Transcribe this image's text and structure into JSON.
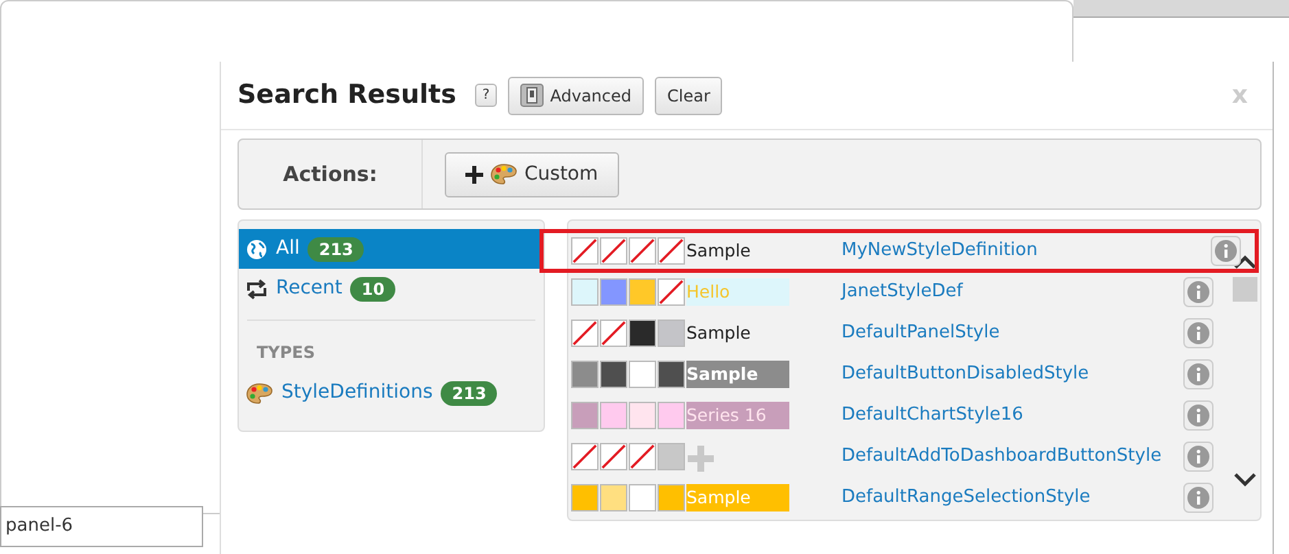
{
  "background_field": {
    "value": "panel-6"
  },
  "dialog": {
    "title": "Search Results",
    "help": "?",
    "advanced": "Advanced",
    "clear": "Clear",
    "close": "x"
  },
  "actions": {
    "label": "Actions:",
    "button": "Custom"
  },
  "sidebar": {
    "items": [
      {
        "label": "All",
        "count": "213",
        "selected": true
      },
      {
        "label": "Recent",
        "count": "10",
        "selected": false
      }
    ],
    "section": "TYPES",
    "types": [
      {
        "label": "StyleDefinitions",
        "count": "213"
      }
    ]
  },
  "results": [
    {
      "swatches": [
        {
          "kind": "none"
        },
        {
          "kind": "none"
        },
        {
          "kind": "none"
        },
        {
          "kind": "none"
        }
      ],
      "sample": {
        "kind": "text",
        "text": "Sample",
        "color": "#222222",
        "bold": false
      },
      "name": "MyNewStyleDefinition",
      "selected": true
    },
    {
      "swatches": [
        {
          "kind": "color",
          "color": "#ddf6fb"
        },
        {
          "kind": "color",
          "color": "#8396ff"
        },
        {
          "kind": "color",
          "color": "#ffc828"
        },
        {
          "kind": "none"
        }
      ],
      "sample": {
        "kind": "text",
        "text": "Hello",
        "color": "#f5c52b",
        "fill": {
          "color": "#ddf6fb"
        },
        "bold": false
      },
      "name": "JanetStyleDef",
      "selected": false
    },
    {
      "swatches": [
        {
          "kind": "none"
        },
        {
          "kind": "none"
        },
        {
          "kind": "color",
          "color": "#2a2a2a"
        },
        {
          "kind": "color",
          "color": "#c4c4c8"
        }
      ],
      "sample": {
        "kind": "text",
        "text": "Sample",
        "color": "#222222",
        "bold": false
      },
      "name": "DefaultPanelStyle",
      "selected": false
    },
    {
      "swatches": [
        {
          "kind": "color",
          "color": "#8c8c8c"
        },
        {
          "kind": "color",
          "color": "#4f4f4f"
        },
        {
          "kind": "color",
          "color": "#ffffff"
        },
        {
          "kind": "color",
          "color": "#4f4f4f"
        }
      ],
      "sample": {
        "kind": "text",
        "text": "Sample",
        "color": "#ffffff",
        "fill": {
          "color": "#8c8c8c"
        },
        "bold": true
      },
      "name": "DefaultButtonDisabledStyle",
      "selected": false
    },
    {
      "swatches": [
        {
          "kind": "color",
          "color": "#c89eba"
        },
        {
          "kind": "color",
          "color": "#ffcaee"
        },
        {
          "kind": "color",
          "color": "#ffe4ee"
        },
        {
          "kind": "color",
          "color": "#ffcaee"
        }
      ],
      "sample": {
        "kind": "text",
        "text": "Series 16",
        "color": "#ffe4ee",
        "fill": {
          "color": "#c89eba"
        },
        "bold": false
      },
      "name": "DefaultChartStyle16",
      "selected": false
    },
    {
      "swatches": [
        {
          "kind": "none"
        },
        {
          "kind": "none"
        },
        {
          "kind": "none"
        },
        {
          "kind": "color",
          "color": "#c8c8c8"
        }
      ],
      "sample": {
        "kind": "plus"
      },
      "name": "DefaultAddToDashboardButtonStyle",
      "selected": false
    },
    {
      "swatches": [
        {
          "kind": "color",
          "color": "#ffbf00"
        },
        {
          "kind": "color",
          "color": "#ffdf80"
        },
        {
          "kind": "color",
          "color": "#ffffff"
        },
        {
          "kind": "color",
          "color": "#ffbf00"
        }
      ],
      "sample": {
        "kind": "text",
        "text": "Sample",
        "color": "#ffffff",
        "fill": {
          "color": "#ffbf00"
        },
        "bold": false
      },
      "name": "DefaultRangeSelectionStyle",
      "selected": false
    }
  ]
}
